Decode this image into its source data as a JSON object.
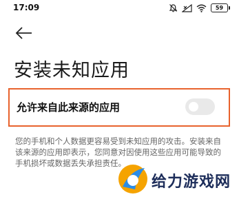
{
  "status_bar": {
    "time": "17:09",
    "battery_level": "59",
    "icons": [
      "alarm-off-icon",
      "signal-icon",
      "wifi-icon",
      "battery-icon"
    ]
  },
  "header": {
    "back_icon": "back-arrow-icon",
    "title": "安装未知应用"
  },
  "setting": {
    "label": "允许来自此来源的应用",
    "enabled": false,
    "highlight_color": "#e8622c"
  },
  "warning_text": "您的手机和个人数据更容易受到未知应用的攻击。安装来自该来源的应用即表示，您同意对因使用这些应用可能导致的手机损坏或数据丢失承担责任。",
  "watermark": {
    "text": "给力游戏网",
    "logo_colors": [
      "#f5a300",
      "#2b8ce6"
    ]
  }
}
